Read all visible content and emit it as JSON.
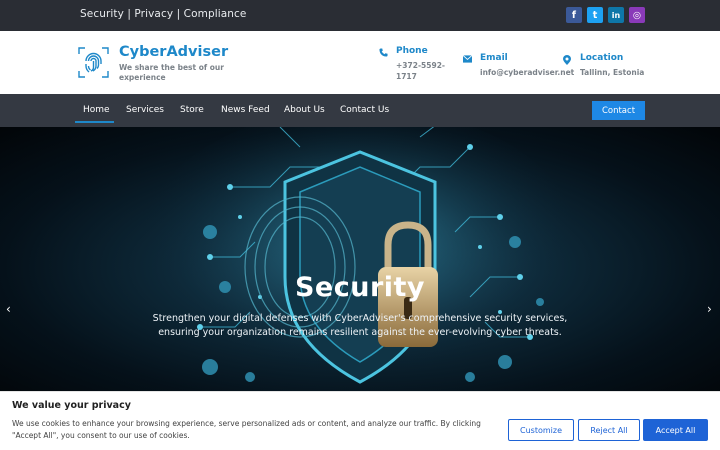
{
  "topbar": {
    "links": "Security | Privacy | Compliance",
    "social": [
      {
        "icon": "facebook-icon",
        "glyph": "f",
        "color": "#3b5998"
      },
      {
        "icon": "twitter-icon",
        "glyph": "t",
        "color": "#1da1f2"
      },
      {
        "icon": "linkedin-icon",
        "glyph": "in",
        "color": "#0e76a8"
      },
      {
        "icon": "instagram-icon",
        "glyph": "◎",
        "color": "#8a3ab9"
      }
    ]
  },
  "header": {
    "brand": "CyberAdviser",
    "tagline": "We share the best of our experience",
    "phone": {
      "label": "Phone",
      "value": "+372-5592-1717",
      "line1": "+372-5592-",
      "line2": "1717"
    },
    "email": {
      "label": "Email",
      "value": "info@cyberadviser.net"
    },
    "location": {
      "label": "Location",
      "value": "Tallinn, Estonia"
    }
  },
  "nav": {
    "items": [
      "Home",
      "Services",
      "Store",
      "News Feed",
      "About Us",
      "Contact Us"
    ],
    "active": "Home",
    "cta": "Contact"
  },
  "hero": {
    "title": "Security",
    "text": "Strengthen your digital defenses with CyberAdviser's comprehensive security services, ensuring your organization remains resilient against the ever-evolving cyber threats.",
    "prev": "‹",
    "next": "›"
  },
  "cookie": {
    "title": "We value your privacy",
    "text": "We use cookies to enhance your browsing experience, serve personalized ads or content, and analyze our traffic. By clicking \"Accept All\", you consent to our use of cookies.",
    "customize": "Customize",
    "reject": "Reject All",
    "accept": "Accept All"
  },
  "colors": {
    "accent": "#1e88c9",
    "topbar": "#2a2d34",
    "nav": "#343942",
    "button": "#1e63d6"
  }
}
